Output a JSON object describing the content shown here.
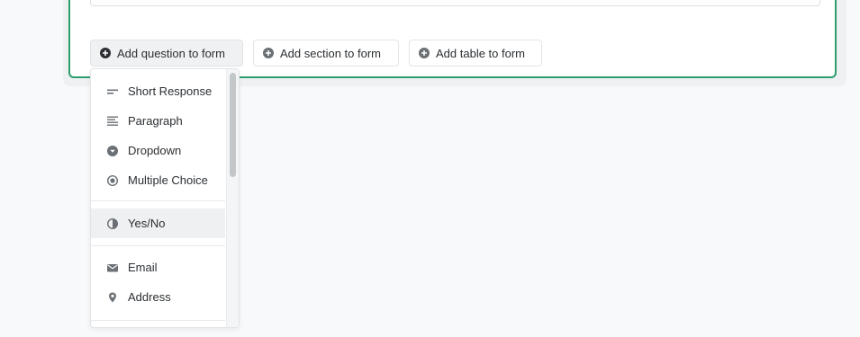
{
  "toolbar": {
    "add_question_label": "Add question to form",
    "add_section_label": "Add section to form",
    "add_table_label": "Add table to form"
  },
  "question_menu": {
    "items": [
      {
        "label": "Short Response",
        "icon": "short-text-icon"
      },
      {
        "label": "Paragraph",
        "icon": "paragraph-icon"
      },
      {
        "label": "Dropdown",
        "icon": "dropdown-icon"
      },
      {
        "label": "Multiple Choice",
        "icon": "radio-icon"
      },
      {
        "label": "Yes/No",
        "icon": "half-circle-icon"
      },
      {
        "label": "Email",
        "icon": "envelope-icon"
      },
      {
        "label": "Address",
        "icon": "location-pin-icon"
      }
    ],
    "hovered_item": "Yes/No"
  },
  "colors": {
    "card_border": "#2e9e6e",
    "hover_bg": "#eef0f2",
    "icon": "#6b7075"
  }
}
